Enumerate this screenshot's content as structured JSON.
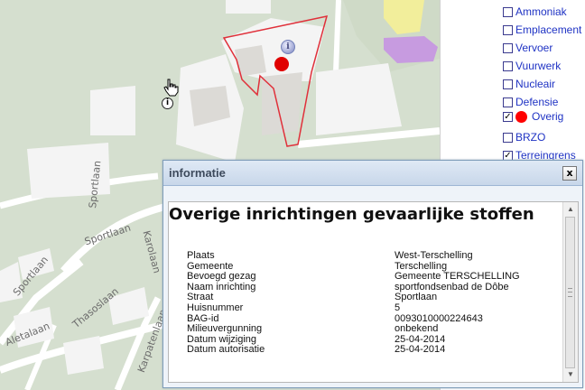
{
  "map": {
    "streets": [
      "Sportlaan",
      "Sportlaan",
      "Sportlaan",
      "Thasoslaan",
      "Aletalaan",
      "Karpatenlaan",
      "Karolaan"
    ]
  },
  "layers": [
    {
      "label": "Ammoniak",
      "checked": false
    },
    {
      "label": "Emplacement",
      "checked": false
    },
    {
      "label": "Vervoer",
      "checked": false
    },
    {
      "label": "Vuurwerk",
      "checked": false
    },
    {
      "label": "Nucleair",
      "checked": false
    },
    {
      "label": "Defensie",
      "checked": false
    },
    {
      "label": "Overig",
      "checked": true,
      "legend_color": "#ff0000"
    },
    {
      "label": "BRZO",
      "checked": false
    },
    {
      "label": "Terreingrens",
      "checked": true
    }
  ],
  "popup": {
    "title": "informatie",
    "close": "x",
    "heading": "Overige inrichtingen gevaarlijke stoffen",
    "properties": [
      {
        "key": "Plaats",
        "value": "West-Terschelling"
      },
      {
        "key": "Gemeente",
        "value": "Terschelling"
      },
      {
        "key": "Bevoegd gezag",
        "value": "Gemeente TERSCHELLING"
      },
      {
        "key": "Naam inrichting",
        "value": "sportfondsenbad de Dôbe"
      },
      {
        "key": "Straat",
        "value": "Sportlaan"
      },
      {
        "key": "Huisnummer",
        "value": "5"
      },
      {
        "key": "BAG-id",
        "value": "0093010000224643"
      },
      {
        "key": "Milieuvergunning",
        "value": "onbekend"
      },
      {
        "key": "Datum wijziging",
        "value": "25-04-2014"
      },
      {
        "key": "Datum autorisatie",
        "value": "25-04-2014"
      }
    ]
  },
  "icons": {
    "cursor": "hand-pointer-icon",
    "info_cursor": "info-icon",
    "map_marker": "info-pin-icon",
    "scroll_up": "arrow-up-icon",
    "scroll_down": "arrow-down-icon"
  },
  "colors": {
    "map_background": "#d5dfcf",
    "buildings": "#f4f4f4",
    "building_grey": "#dcdad6",
    "selection_outline": "#e0303a",
    "marker": "#e00000",
    "layer_link": "#1f33c4",
    "yellow_zone": "#f2ee9b",
    "purple_zone": "#c79be0"
  }
}
